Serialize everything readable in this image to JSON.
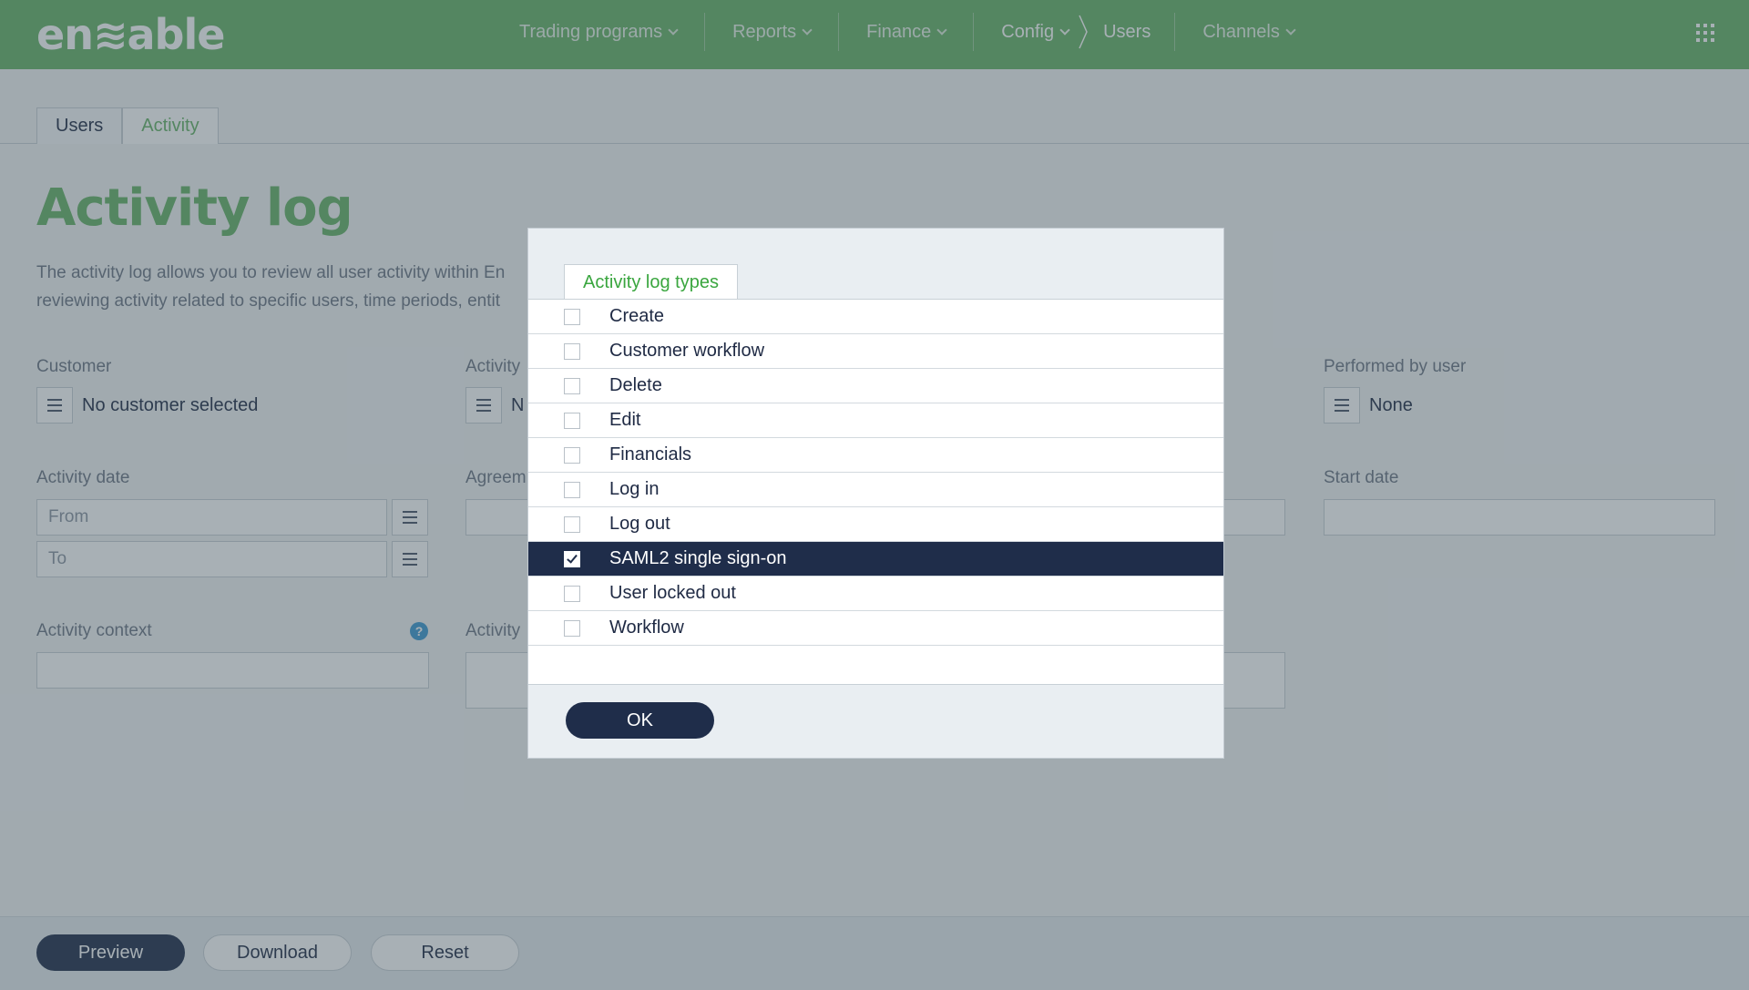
{
  "app": {
    "logo_text": "en≋able"
  },
  "nav": {
    "items": [
      {
        "label": "Trading programs"
      },
      {
        "label": "Reports"
      },
      {
        "label": "Finance"
      },
      {
        "label": "Config"
      },
      {
        "label": "Channels"
      }
    ],
    "breadcrumb_current": "Users"
  },
  "tabs": [
    {
      "label": "Users",
      "active": false
    },
    {
      "label": "Activity",
      "active": true
    }
  ],
  "page": {
    "title": "Activity log",
    "description_line1": "The activity log allows you to review all user activity within En",
    "description_line2": "reviewing activity related to specific users, time periods, entit"
  },
  "filters": {
    "customer_label": "Customer",
    "customer_value": "No customer selected",
    "activity_label": "Activity",
    "activity_value": "N",
    "performed_by_label": "Performed by user",
    "performed_by_value": "None",
    "activity_date_label": "Activity date",
    "from_placeholder": "From",
    "to_placeholder": "To",
    "agreement_label": "Agreem",
    "start_date_label": "Start date",
    "activity_context_label": "Activity context",
    "activity_label_2": "Activity",
    "help_glyph": "?"
  },
  "footer": {
    "preview_label": "Preview",
    "download_label": "Download",
    "reset_label": "Reset"
  },
  "modal": {
    "tab_label": "Activity log types",
    "items": [
      {
        "label": "Create",
        "checked": false
      },
      {
        "label": "Customer workflow",
        "checked": false
      },
      {
        "label": "Delete",
        "checked": false
      },
      {
        "label": "Edit",
        "checked": false
      },
      {
        "label": "Financials",
        "checked": false
      },
      {
        "label": "Log in",
        "checked": false
      },
      {
        "label": "Log out",
        "checked": false
      },
      {
        "label": "SAML2 single sign-on",
        "checked": true
      },
      {
        "label": "User locked out",
        "checked": false
      },
      {
        "label": "Workflow",
        "checked": false
      }
    ],
    "ok_label": "OK"
  },
  "colors": {
    "brand_green": "#67b266",
    "navy": "#1f2d4a",
    "overlay": "#3e505c"
  }
}
